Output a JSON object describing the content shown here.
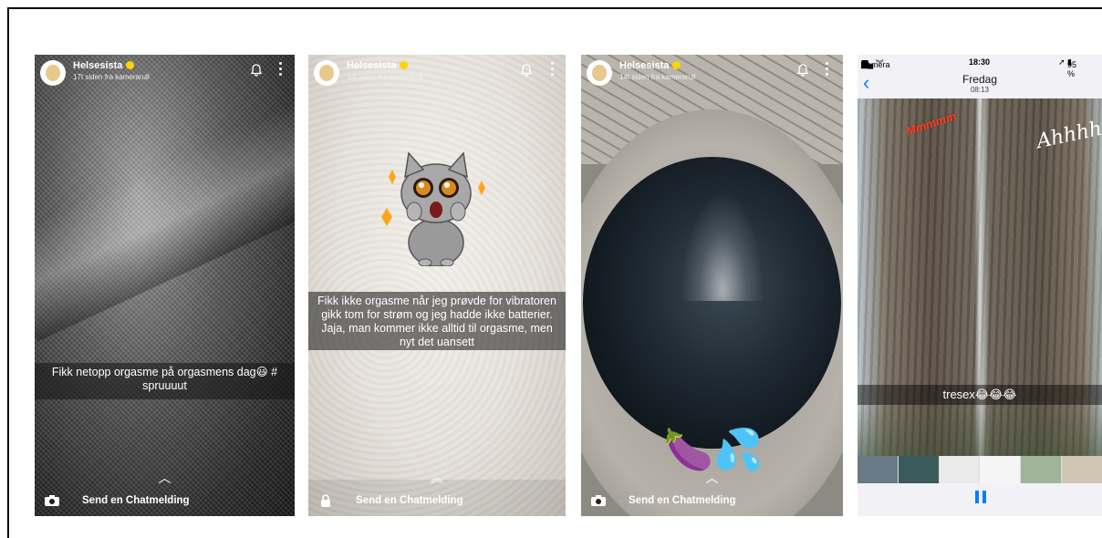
{
  "snaps": [
    {
      "username": "Helsesista",
      "meta": "17t siden fra kamerarull",
      "caption": "Fikk netopp orgasme på orgasmens dag😃 # spruuuut",
      "chat_label": "Send en Chatmelding"
    },
    {
      "username": "Helsesista",
      "meta": "14t siden fra kamerarull",
      "caption": "Fikk ikke orgasme når jeg prøvde for vibratoren gikk tom for strøm og jeg hadde ikke batterier. Jaja, man kommer ikke alltid til orgasme, men nyt det uansett",
      "chat_label": "Send en Chatmelding"
    },
    {
      "username": "Helsesista",
      "meta": "14t siden fra kamerarull",
      "emoji": "🍆💦",
      "chat_label": "Send en Chatmelding"
    }
  ],
  "ios_viewer": {
    "carrier": "Kamera",
    "clock": "18:30",
    "battery": "95 %",
    "day": "Fredag",
    "time": "08:13",
    "back": "‹",
    "scribble": "Mmmmm",
    "handwriting": "Ahhhh",
    "caption": "tresex😂😂😂"
  },
  "colors": {
    "snap_yellow": "#ffd400",
    "ios_blue": "#0a7cff"
  }
}
